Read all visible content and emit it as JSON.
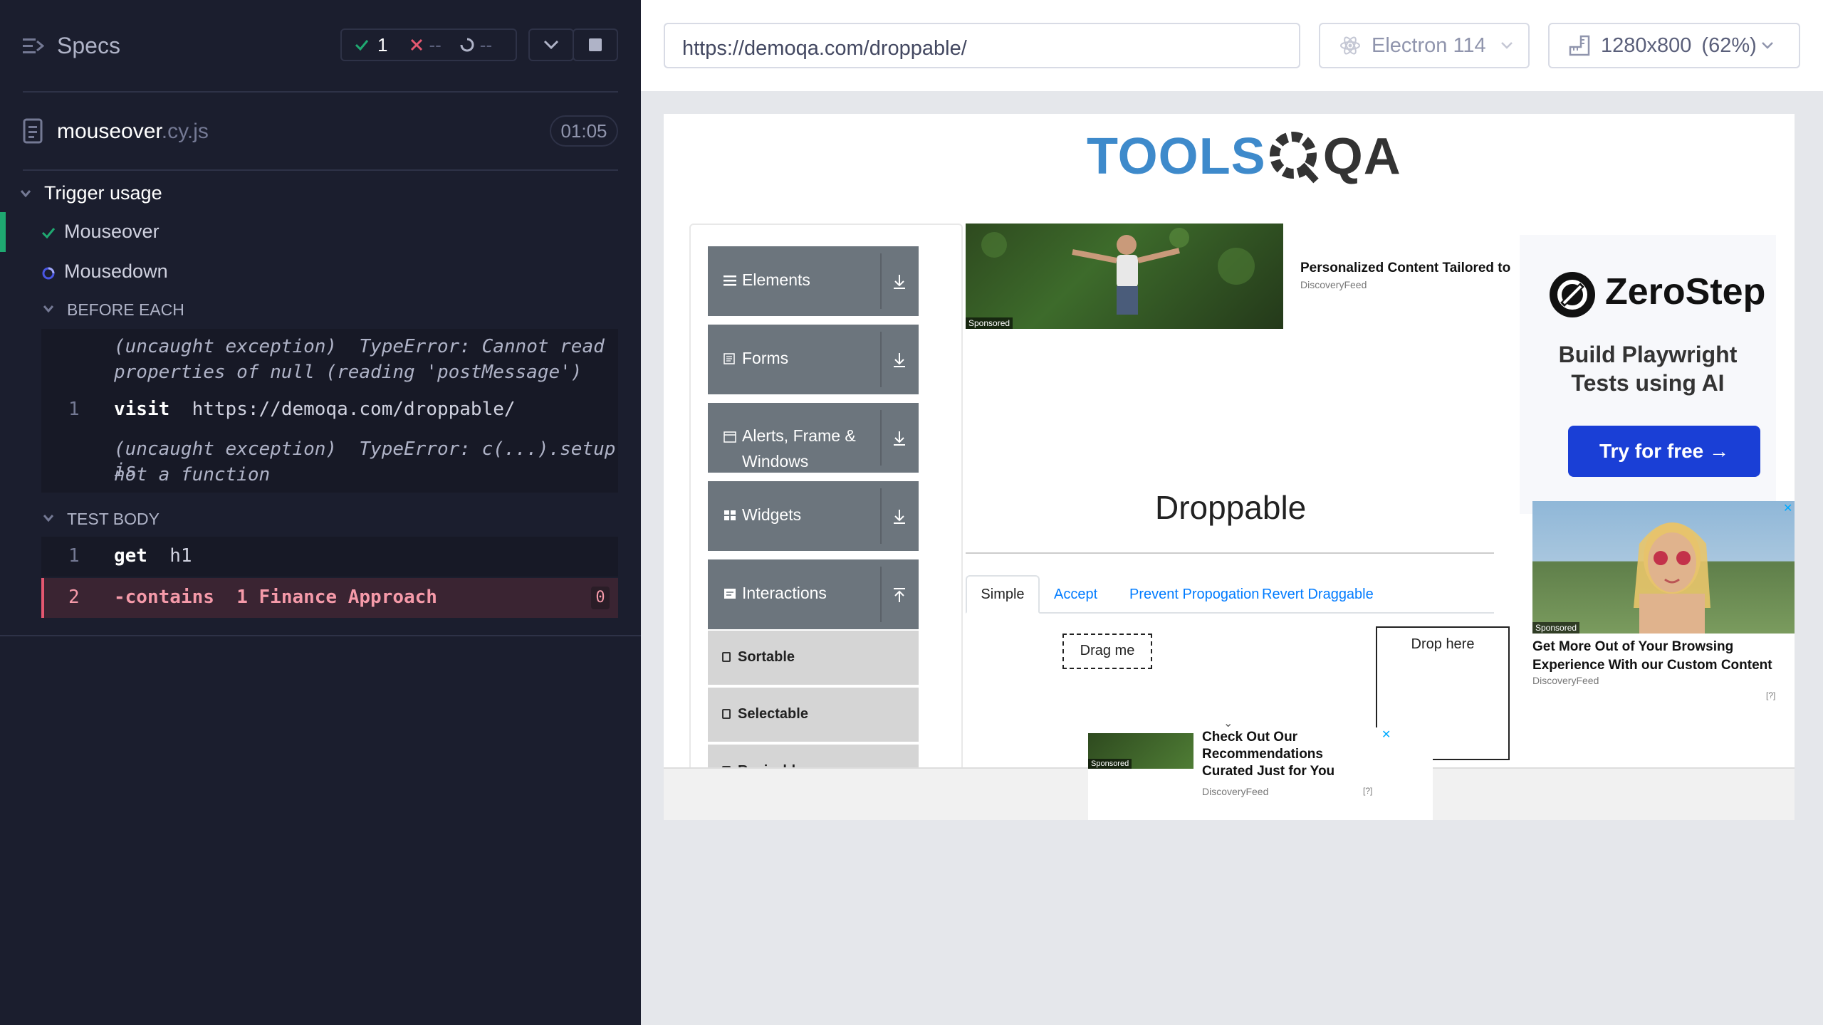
{
  "runner": {
    "specs_label": "Specs",
    "passed_count": "1",
    "failed_count": "--",
    "pending_count": "--",
    "spec_name": "mouseover",
    "spec_ext": ".cy.js",
    "duration": "01:05",
    "suite_title": "Trigger usage",
    "tests": [
      {
        "label": "Mouseover",
        "state": "passed"
      },
      {
        "label": "Mousedown",
        "state": "running"
      }
    ],
    "before_each_label": "BEFORE EACH",
    "before_each": {
      "error1_line1_a": "(uncaught exception)",
      "error1_line1_b": "TypeError: Cannot read",
      "error1_line2": "properties of null (reading 'postMessage')",
      "cmd_num": "1",
      "cmd_name": "visit",
      "cmd_arg": "https://demoqa.com/droppable/",
      "error2_line1_a": "(uncaught exception)",
      "error2_line1_b": "TypeError: c(...).setup is",
      "error2_line2": "not a function"
    },
    "test_body_label": "TEST BODY",
    "test_body": [
      {
        "num": "1",
        "name": "get",
        "arg": "h1"
      },
      {
        "num": "2",
        "name": "-contains",
        "arg": "1 Finance Approach",
        "badge": "0"
      }
    ]
  },
  "browser": {
    "url": "https://demoqa.com/droppable/",
    "browser_name": "Electron 114",
    "viewport_label": "1280x800",
    "viewport_scale": "(62%)"
  },
  "page": {
    "logo_text_a": "TOOLS",
    "logo_text_b": "QA",
    "menu_groups": [
      {
        "label": "Elements"
      },
      {
        "label": "Forms"
      },
      {
        "label_line1": "Alerts, Frame &",
        "label_line2": "Windows"
      },
      {
        "label": "Widgets"
      },
      {
        "label": "Interactions"
      }
    ],
    "submenu": [
      "Sortable",
      "Selectable",
      "Resizable"
    ],
    "ad_top_heading": "Personalized Content Tailored to",
    "ad_top_source": "DiscoveryFeed",
    "sponsored": "Sponsored",
    "page_title": "Droppable",
    "tabs": [
      "Simple",
      "Accept",
      "Prevent Propogation",
      "Revert Draggable"
    ],
    "drag_me": "Drag me",
    "drop_here": "Drop here",
    "zerostep_brand": "ZeroStep",
    "zerostep_tagline_1": "Build Playwright",
    "zerostep_tagline_2": "Tests using AI",
    "zerostep_cta": "Try for free →",
    "ad_right_heading_1": "Get More Out of Your Browsing",
    "ad_right_heading_2": "Experience With our Custom Content",
    "ad_right_source": "DiscoveryFeed",
    "ad_bottom_heading_1": "Check Out Our",
    "ad_bottom_heading_2": "Recommendations",
    "ad_bottom_heading_3": "Curated Just for You",
    "ad_bottom_source": "DiscoveryFeed",
    "ad_info": "[?]"
  }
}
